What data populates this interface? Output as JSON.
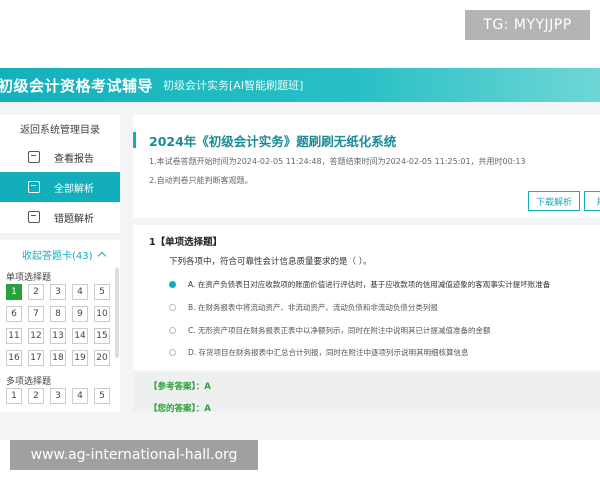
{
  "watermarks": {
    "top": "TG: MYYJJPP",
    "bottom": "www.ag-international-hall.org"
  },
  "header": {
    "brand": "初级会计资格考试辅导",
    "subtitle": "初级会计实务[AI智能刷题班]"
  },
  "sidebar": {
    "back": "返回系统管理目录",
    "items": [
      {
        "label": "查看报告",
        "icon": "report-icon",
        "active": false
      },
      {
        "label": "全部解析",
        "icon": "analysis-icon",
        "active": true
      },
      {
        "label": "错题解析",
        "icon": "wrong-answer-icon",
        "active": false
      }
    ]
  },
  "answer_card": {
    "title": "收起答题卡(43)",
    "single_label": "单项选择题",
    "single_numbers": [
      "1",
      "2",
      "3",
      "4",
      "5",
      "6",
      "7",
      "8",
      "9",
      "10",
      "11",
      "12",
      "13",
      "14",
      "15",
      "16",
      "17",
      "18",
      "19",
      "20"
    ],
    "multi_label": "多项选择题",
    "multi_numbers": [
      "1",
      "2",
      "3",
      "4",
      "5"
    ]
  },
  "main": {
    "title": "2024年《初级会计实务》题刷刷无纸化系统",
    "info": "1.本试卷答题开始时间为2024-02-05 11:24:48，答题结束时间为2024-02-05 11:25:01，共用时00:13",
    "tip": "2.自动判卷只能判断客观题。",
    "download_button": "下载解析",
    "second_button": "刷"
  },
  "question": {
    "type": "1【单项选择题】",
    "stem": "下列各项中，符合可靠性会计信息质量要求的是（   ）。",
    "options": [
      "A. 在资产负债表日对应收款项的账面价值进行评估时，基于应收款项的信用减值迹象的客观事实计提坏账准备",
      "B. 在财务报表中将流动资产、非流动资产、流动负债和非流动负债分类列报",
      "C. 无形资产项目在财务报表正表中以净额列示，同时在附注中说明其已计提减值准备的金额",
      "D. 存货项目在财务报表中汇总合计列报，同时在附注中逐项列示说明其明细核算信息"
    ]
  },
  "answers": {
    "reference": "【参考答案】：A",
    "yours": "【您的答案】：A"
  }
}
